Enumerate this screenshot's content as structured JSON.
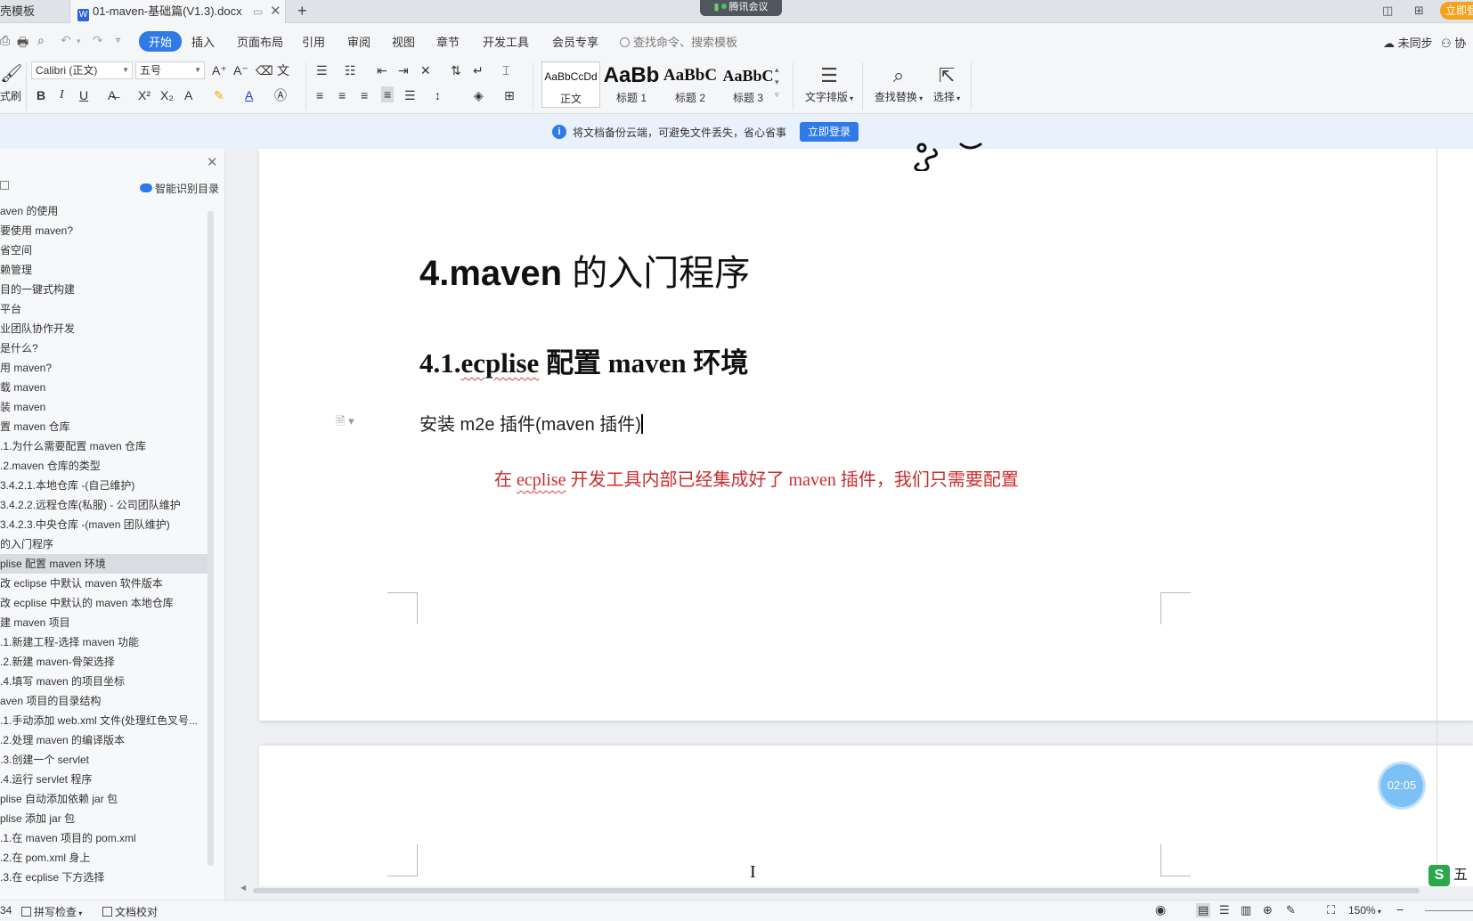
{
  "tabs": {
    "inactive_label": "壳模板",
    "active_label": "01-maven-基础篇(V1.3).docx",
    "add_label": "+",
    "meeting_label": "腾讯会议",
    "login_label": "立即登"
  },
  "menu": {
    "items": [
      "开始",
      "插入",
      "页面布局",
      "引用",
      "审阅",
      "视图",
      "章节",
      "开发工具",
      "会员专享"
    ],
    "active_item": "开始",
    "search_placeholder": "查找命令、搜索模板",
    "sync_label": "未同步",
    "collab_label": "协"
  },
  "ribbon": {
    "format_painter_label": "式刷",
    "font_name": "Calibri (正文)",
    "font_size": "五号",
    "styles": [
      {
        "sample": "AaBbCcDd",
        "label": "正文"
      },
      {
        "sample": "AaBb",
        "label": "标题 1"
      },
      {
        "sample": "AaBbC",
        "label": "标题 2"
      },
      {
        "sample": "AaBbC",
        "label": "标题 3"
      }
    ],
    "text_layout_label": "文字排版",
    "find_replace_label": "查找替换",
    "select_label": "选择"
  },
  "notice": {
    "text": "将文档备份云端，可避免文件丢失，省心省事",
    "button_label": "立即登录"
  },
  "nav": {
    "smart_toc_label": "智能识别目录",
    "current_index": 18,
    "items": [
      "aven 的使用",
      "要使用 maven?",
      "省空间",
      "赖管理",
      "目的一键式构建",
      "平台",
      "业团队协作开发",
      "是什么?",
      "用 maven?",
      "载 maven",
      "装 maven",
      "置 maven 仓库",
      ".1.为什么需要配置 maven 仓库",
      ".2.maven 仓库的类型",
      "3.4.2.1.本地仓库 -(自己维护)",
      "3.4.2.2.远程仓库(私服) - 公司团队维护",
      "3.4.2.3.中央仓库 -(maven 团队维护)",
      "的入门程序",
      "plise 配置 maven 环境",
      "改 eclipse 中默认 maven 软件版本",
      "改 ecplise 中默认的 maven 本地仓库",
      "建 maven 项目",
      ".1.新建工程-选择 maven 功能",
      ".2.新建 maven-骨架选择",
      ".4.填写 maven 的项目坐标",
      "aven 项目的目录结构",
      ".1.手动添加 web.xml 文件(处理红色叉号...",
      ".2.处理 maven 的编译版本",
      ".3.创建一个 servlet",
      ".4.运行 servlet 程序",
      "plise 自动添加依赖 jar 包",
      "plise 添加 jar 包",
      ".1.在 maven 项目的 pom.xml",
      ".2.在 pom.xml 身上",
      ".3.在 ecplise 下方选择"
    ]
  },
  "document": {
    "heading1_bold": "4.maven",
    "heading1_rest": " 的入门程序",
    "heading2_prefix": "4.1.",
    "heading2_squiggle": "ecplise",
    "heading2_rest": " 配置 maven 环境",
    "paragraph1": "安装 m2e 插件(maven 插件)",
    "paragraph2_pre": "在 ",
    "paragraph2_squiggle": "ecplise",
    "paragraph2_post": " 开发工具内部已经集成好了 maven 插件，我们只需要配置"
  },
  "overlay": {
    "timer": "02:05",
    "ime_label": "五"
  },
  "status": {
    "page_num": "34",
    "spell_check": "拼写检查",
    "doc_proof": "文档校对",
    "zoom": "150%"
  },
  "colors": {
    "accent": "#2f7ae5",
    "red_text": "#cc2b2b",
    "login_orange": "#f6a21c"
  }
}
